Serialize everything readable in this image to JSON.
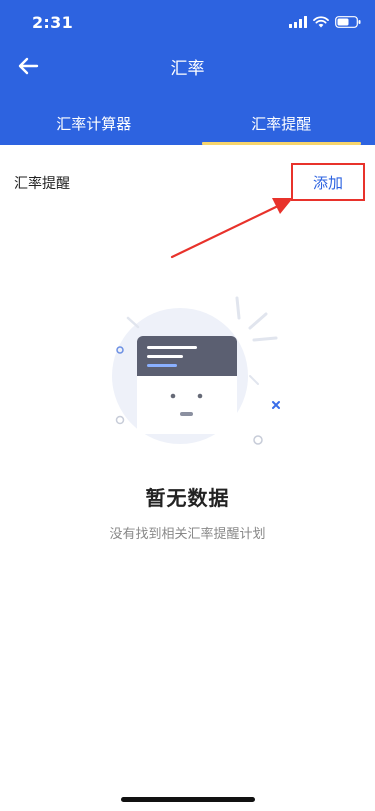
{
  "status_bar": {
    "time": "2:31"
  },
  "nav": {
    "back_icon": "arrow-left-icon",
    "title": "汇率"
  },
  "tabs": [
    {
      "label": "汇率计算器",
      "active": false
    },
    {
      "label": "汇率提醒",
      "active": true
    }
  ],
  "section": {
    "title": "汇率提醒",
    "add_label": "添加"
  },
  "empty_state": {
    "title": "暂无数据",
    "description": "没有找到相关汇率提醒计划"
  },
  "colors": {
    "primary": "#2d63e0",
    "tab_indicator": "#f7d56c",
    "annotation": "#e8322b"
  }
}
